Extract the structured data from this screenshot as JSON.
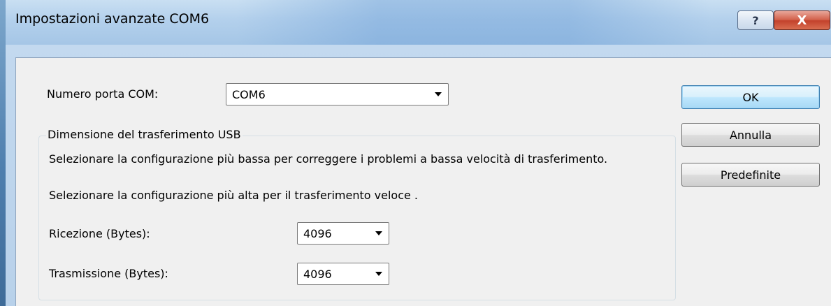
{
  "window": {
    "title": "Impostazioni avanzate COM6",
    "help_label": "?",
    "close_label": "X"
  },
  "com_port": {
    "label": "Numero porta COM:",
    "value": "COM6"
  },
  "usb_transfer": {
    "group_label": "Dimensione del trasferimento USB",
    "hint_low": "Selezionare la configurazione più bassa per correggere i problemi a bassa velocità di trasferimento.",
    "hint_high": "Selezionare la configurazione più alta per il trasferimento veloce .",
    "receive": {
      "label": "Ricezione (Bytes):",
      "value": "4096"
    },
    "transmit": {
      "label": "Trasmissione (Bytes):",
      "value": "4096"
    }
  },
  "buttons": {
    "ok": "OK",
    "cancel": "Annulla",
    "defaults": "Predefinite"
  },
  "colors": {
    "title_bar": "#b3d0ec",
    "client_background": "#f0f0f0",
    "close_button": "#c3412b",
    "default_button_border": "#3c7fb1"
  }
}
